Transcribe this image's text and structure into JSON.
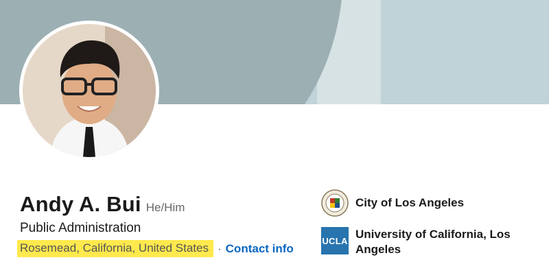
{
  "profile": {
    "name": "Andy A. Bui",
    "pronouns": "He/Him",
    "headline": "Public Administration",
    "location": "Rosemead, California, United States",
    "separator": "·",
    "contact_label": "Contact info"
  },
  "experience": {
    "org_name": "City of Los Angeles",
    "logo_icon": "city-seal-icon"
  },
  "education": {
    "org_name": "University of California, Los Angeles",
    "logo_text": "UCLA",
    "logo_color": "#2774ae"
  },
  "colors": {
    "location_highlight": "#ffe94d",
    "link": "#0a66c2"
  }
}
